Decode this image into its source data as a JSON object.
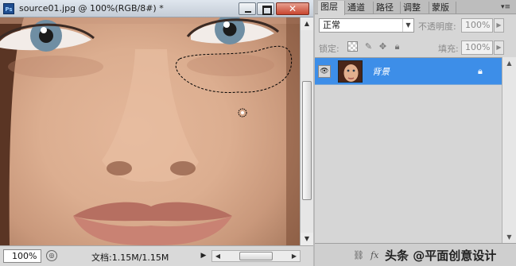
{
  "document": {
    "app_logo": "Ps",
    "title": "source01.jpg @ 100%(RGB/8#) *",
    "window_controls": {
      "close_glyph": "✕"
    },
    "status": {
      "zoom": "100%",
      "doc_size": "文档:1.15M/1.15M"
    }
  },
  "layers_panel": {
    "tabs": [
      {
        "label": "图层",
        "active": true
      },
      {
        "label": "通道",
        "active": false
      },
      {
        "label": "路径",
        "active": false
      },
      {
        "label": "调整",
        "active": false
      },
      {
        "label": "蒙版",
        "active": false
      }
    ],
    "blend_mode": "正常",
    "opacity_label": "不透明度:",
    "opacity_value": "100%",
    "lock_label": "锁定:",
    "fill_label": "填充:",
    "fill_value": "100%",
    "layers": [
      {
        "name": "背景",
        "visible": true,
        "locked": true,
        "selected": true
      }
    ],
    "footer": {
      "fx_label": "fx",
      "watermark": "头条 @平面创意设计"
    }
  },
  "colors": {
    "selection_highlight": "#3d8ee8",
    "close_button": "#c8452f"
  }
}
